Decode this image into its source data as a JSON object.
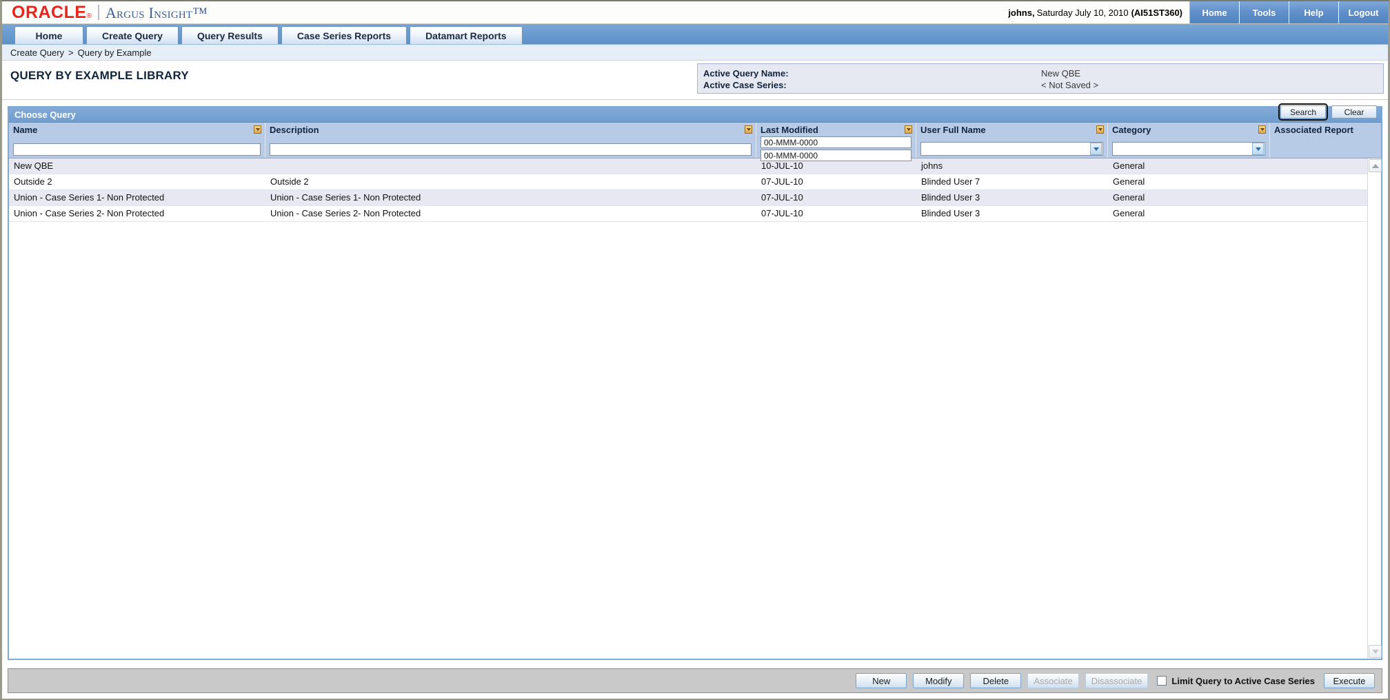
{
  "brand": {
    "oracle": "ORACLE",
    "registered": "®",
    "product": "Argus Insight",
    "tm": "™"
  },
  "header": {
    "user_name": "johns,",
    "session_date": "Saturday July 10, 2010",
    "session_code": "(AI51ST360)",
    "util_links": [
      {
        "label": "Home",
        "name": "util-link-home"
      },
      {
        "label": "Tools",
        "name": "util-link-tools"
      },
      {
        "label": "Help",
        "name": "util-link-help"
      },
      {
        "label": "Logout",
        "name": "util-link-logout"
      }
    ]
  },
  "tabs": [
    {
      "label": "Home"
    },
    {
      "label": "Create Query"
    },
    {
      "label": "Query Results"
    },
    {
      "label": "Case Series Reports"
    },
    {
      "label": "Datamart Reports"
    }
  ],
  "breadcrumb": {
    "first": "Create Query",
    "separator": ">",
    "second": "Query by Example"
  },
  "page": {
    "title": "QUERY BY EXAMPLE LIBRARY"
  },
  "active_panel": {
    "query_name_label": "Active Query Name:",
    "query_name_value": "New QBE",
    "case_series_label": "Active Case Series:",
    "case_series_value": "< Not Saved >"
  },
  "panel": {
    "title": "Choose Query",
    "search_label": "Search",
    "clear_label": "Clear"
  },
  "grid": {
    "columns": [
      {
        "label": "Name",
        "filter_type": "text",
        "filter_value": "",
        "sortable": true
      },
      {
        "label": "Description",
        "filter_type": "text",
        "filter_value": "",
        "sortable": true
      },
      {
        "label": "Last Modified",
        "filter_type": "dates",
        "filter_from": "00-MMM-0000",
        "filter_to": "00-MMM-0000",
        "sortable": true
      },
      {
        "label": "User Full Name",
        "filter_type": "select",
        "filter_value": "",
        "sortable": true
      },
      {
        "label": "Category",
        "filter_type": "select",
        "filter_value": "",
        "sortable": true
      },
      {
        "label": "Associated Report",
        "filter_type": "none",
        "sortable": false
      }
    ],
    "rows": [
      {
        "name": "New QBE",
        "description": "",
        "last_modified": "10-JUL-10",
        "user_full_name": "johns",
        "category": "General",
        "associated_report": ""
      },
      {
        "name": "Outside 2",
        "description": "Outside 2",
        "last_modified": "07-JUL-10",
        "user_full_name": "Blinded User 7",
        "category": "General",
        "associated_report": ""
      },
      {
        "name": "Union - Case Series 1- Non Protected",
        "description": "Union - Case Series 1- Non Protected",
        "last_modified": "07-JUL-10",
        "user_full_name": "Blinded User 3",
        "category": "General",
        "associated_report": ""
      },
      {
        "name": "Union - Case Series 2- Non Protected",
        "description": "Union - Case Series 2- Non Protected",
        "last_modified": "07-JUL-10",
        "user_full_name": "Blinded User 3",
        "category": "General",
        "associated_report": ""
      }
    ]
  },
  "toolbar": {
    "new_label": "New",
    "modify_label": "Modify",
    "delete_label": "Delete",
    "associate_label": "Associate",
    "disassociate_label": "Disassociate",
    "limit_label": "Limit Query to Active Case Series",
    "limit_checked": false,
    "execute_label": "Execute"
  },
  "colors": {
    "oracle_red": "#e8241b",
    "product_blue": "#3b5d95",
    "tab_blue": "#6b9ccf",
    "panel_header": "#6f9ecf",
    "row_alt": "#e8e8f2",
    "toolbar_gray": "#c9c9c9",
    "sort_icon": "#e0a84e"
  }
}
